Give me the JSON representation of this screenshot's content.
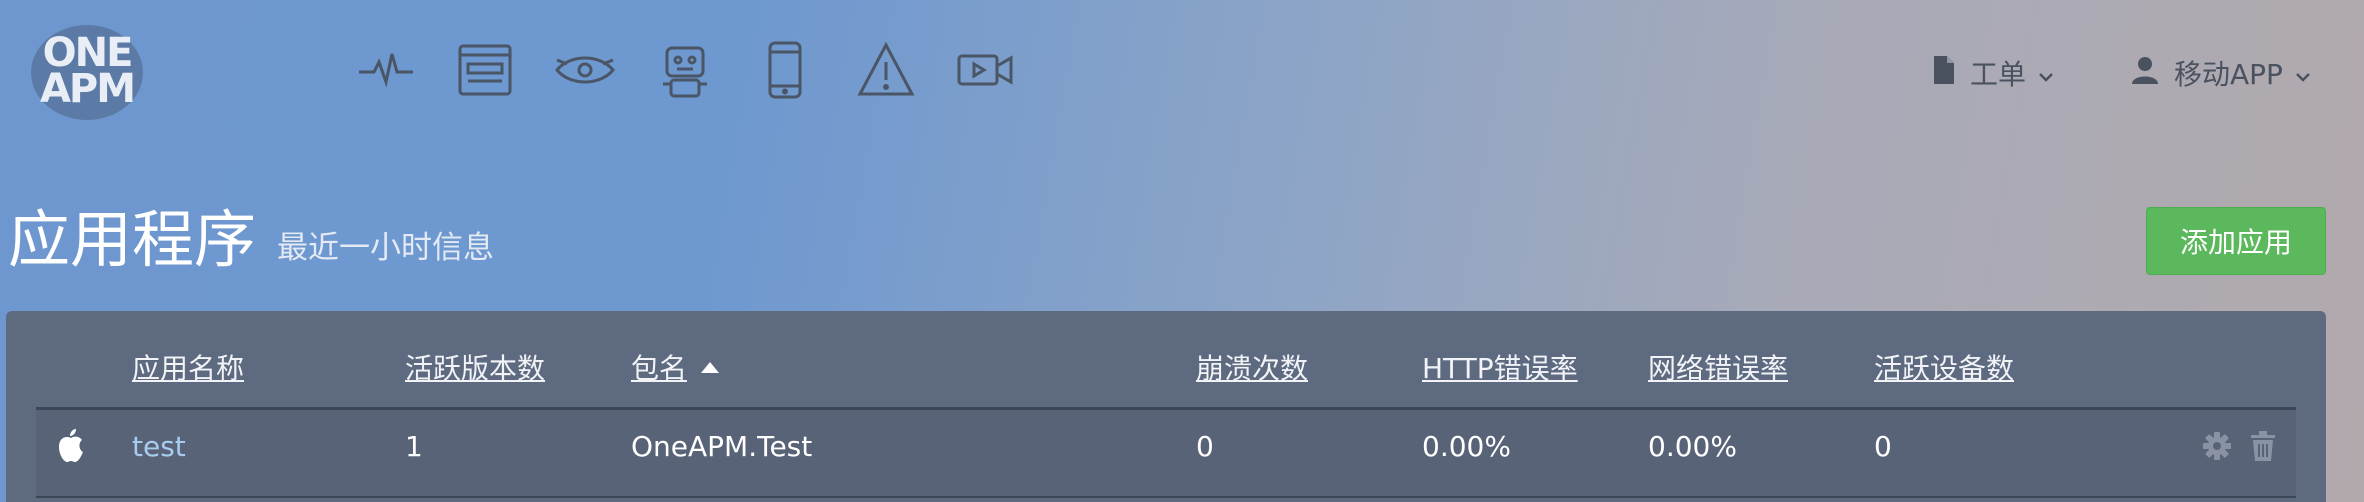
{
  "brand": {
    "logo_line1": "ONE",
    "logo_line2": "APM"
  },
  "nav_icons": [
    "pulse-icon",
    "browser-icon",
    "eye-icon",
    "robot-icon",
    "mobile-icon",
    "alert-icon",
    "video-icon"
  ],
  "header_menu": {
    "ticket": {
      "label": "工单",
      "icon": "document-icon"
    },
    "app": {
      "label": "移动APP",
      "icon": "user-icon"
    }
  },
  "page": {
    "title": "应用程序",
    "subtitle": "最近一小时信息",
    "add_button": "添加应用"
  },
  "table": {
    "columns": [
      "应用名称",
      "活跃版本数",
      "包名",
      "崩溃次数",
      "HTTP错误率",
      "网络错误率",
      "活跃设备数"
    ],
    "sorted_column": "包名",
    "rows": [
      {
        "platform_icon": "apple-icon",
        "name": "test",
        "versions": "1",
        "package": "OneAPM.Test",
        "crashes": "0",
        "http_error": "0.00%",
        "network_error": "0.00%",
        "devices": "0"
      }
    ]
  },
  "colors": {
    "accent_green": "#5cb85c",
    "link": "#a7ccef",
    "panel": "#5d6a80"
  }
}
